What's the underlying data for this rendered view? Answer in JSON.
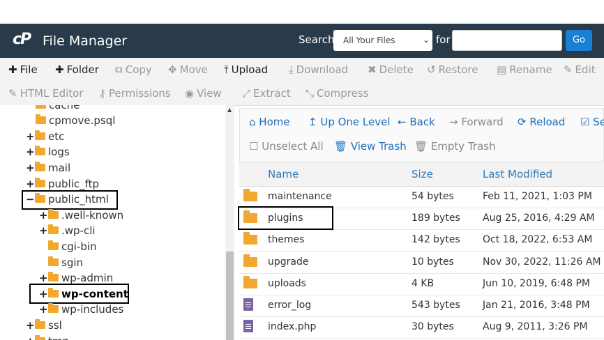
{
  "header": {
    "logo": "cP",
    "title": "File Manager",
    "search_label": "Search",
    "search_scope": "All Your Files",
    "for_label": "for",
    "search_value": "",
    "go_label": "Go"
  },
  "toolbar": {
    "row1": [
      {
        "label": "File",
        "icon": "plus-icon",
        "glyph": "✚",
        "enabled": true
      },
      {
        "label": "Folder",
        "icon": "plus-icon",
        "glyph": "✚",
        "enabled": true
      },
      {
        "label": "Copy",
        "icon": "copy-icon",
        "glyph": "⧉",
        "enabled": false
      },
      {
        "label": "Move",
        "icon": "move-icon",
        "glyph": "✥",
        "enabled": false
      },
      {
        "label": "Upload",
        "icon": "upload-icon",
        "glyph": "⤒",
        "enabled": true
      },
      {
        "label": "Download",
        "icon": "download-icon",
        "glyph": "⤓",
        "enabled": false
      },
      {
        "label": "Delete",
        "icon": "delete-icon",
        "glyph": "✖",
        "enabled": false
      },
      {
        "label": "Restore",
        "icon": "restore-icon",
        "glyph": "↺",
        "enabled": false
      },
      {
        "label": "Rename",
        "icon": "rename-icon",
        "glyph": "▤",
        "enabled": false
      },
      {
        "label": "Edit",
        "icon": "edit-icon",
        "glyph": "✎",
        "enabled": false
      }
    ],
    "row2": [
      {
        "label": "HTML Editor",
        "icon": "html-editor-icon",
        "glyph": "✎",
        "enabled": false
      },
      {
        "label": "Permissions",
        "icon": "key-icon",
        "glyph": "⚷",
        "enabled": false
      },
      {
        "label": "View",
        "icon": "eye-icon",
        "glyph": "◉",
        "enabled": false
      },
      {
        "label": "Extract",
        "icon": "extract-icon",
        "glyph": "⤢",
        "enabled": false
      },
      {
        "label": "Compress",
        "icon": "compress-icon",
        "glyph": "⤡",
        "enabled": false
      }
    ]
  },
  "tree": [
    {
      "label": "cache",
      "pm": "",
      "indent": 2,
      "open": false
    },
    {
      "label": "cpmove.psql",
      "pm": "",
      "indent": 2,
      "open": false
    },
    {
      "label": "etc",
      "pm": "+",
      "indent": 1,
      "open": false
    },
    {
      "label": "logs",
      "pm": "+",
      "indent": 1,
      "open": false
    },
    {
      "label": "mail",
      "pm": "+",
      "indent": 1,
      "open": false
    },
    {
      "label": "public_ftp",
      "pm": "+",
      "indent": 1,
      "open": false
    },
    {
      "label": "public_html",
      "pm": "−",
      "indent": 1,
      "open": true
    },
    {
      "label": ".well-known",
      "pm": "+",
      "indent": 2,
      "open": false
    },
    {
      "label": ".wp-cli",
      "pm": "+",
      "indent": 2,
      "open": false
    },
    {
      "label": "cgi-bin",
      "pm": "",
      "indent": 3,
      "open": false
    },
    {
      "label": "sgin",
      "pm": "",
      "indent": 3,
      "open": false
    },
    {
      "label": "wp-admin",
      "pm": "+",
      "indent": 2,
      "open": false
    },
    {
      "label": "wp-content",
      "pm": "+",
      "indent": 2,
      "open": false,
      "bold": true
    },
    {
      "label": "wp-includes",
      "pm": "+",
      "indent": 2,
      "open": false
    },
    {
      "label": "ssl",
      "pm": "+",
      "indent": 1,
      "open": false
    },
    {
      "label": "tmp",
      "pm": "+",
      "indent": 1,
      "open": false
    }
  ],
  "nav": {
    "home": "Home",
    "up": "Up One Level",
    "back": "Back",
    "forward": "Forward",
    "reload": "Reload",
    "select_all": "Se",
    "unselect_all": "Unselect All",
    "view_trash": "View Trash",
    "empty_trash": "Empty Trash"
  },
  "table": {
    "headers": {
      "name": "Name",
      "size": "Size",
      "modified": "Last Modified"
    },
    "rows": [
      {
        "type": "folder",
        "name": "maintenance",
        "size": "54 bytes",
        "modified": "Feb 11, 2021, 1:03 PM"
      },
      {
        "type": "folder",
        "name": "plugins",
        "size": "189 bytes",
        "modified": "Aug 25, 2016, 4:29 AM"
      },
      {
        "type": "folder",
        "name": "themes",
        "size": "142 bytes",
        "modified": "Oct 18, 2022, 6:53 AM"
      },
      {
        "type": "folder",
        "name": "upgrade",
        "size": "10 bytes",
        "modified": "Nov 30, 2022, 11:26 AM"
      },
      {
        "type": "folder",
        "name": "uploads",
        "size": "4 KB",
        "modified": "Jun 10, 2019, 6:48 PM"
      },
      {
        "type": "file",
        "name": "error_log",
        "size": "543 bytes",
        "modified": "Jan 21, 2016, 3:48 PM"
      },
      {
        "type": "file",
        "name": "index.php",
        "size": "30 bytes",
        "modified": "Aug 9, 2011, 3:26 PM"
      }
    ]
  }
}
